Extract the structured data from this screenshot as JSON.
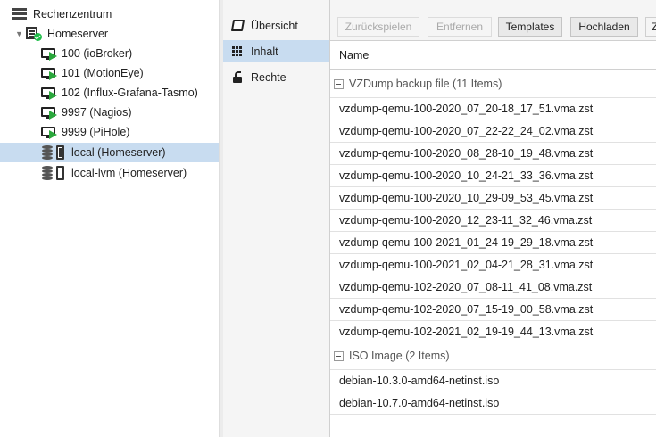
{
  "tree": {
    "datacenter": "Rechenzentrum",
    "node": "Homeserver",
    "vms": [
      {
        "label": "100 (ioBroker)"
      },
      {
        "label": "101 (MotionEye)"
      },
      {
        "label": "102 (Influx-Grafana-Tasmo)"
      },
      {
        "label": "9997 (Nagios)"
      },
      {
        "label": "9999 (PiHole)"
      }
    ],
    "storages": [
      {
        "label": "local (Homeserver)",
        "selected": true
      },
      {
        "label": "local-lvm (Homeserver)",
        "selected": false
      }
    ]
  },
  "nav": {
    "items": [
      {
        "label": "Übersicht",
        "icon": "book-icon"
      },
      {
        "label": "Inhalt",
        "icon": "grid-icon",
        "selected": true
      },
      {
        "label": "Rechte",
        "icon": "unlock-icon"
      }
    ]
  },
  "toolbar": {
    "restore": "Zurückspielen",
    "remove": "Entfernen",
    "templates": "Templates",
    "upload": "Hochladen",
    "overflow": "Z"
  },
  "grid": {
    "column_name": "Name",
    "groups": [
      {
        "title": "VZDump backup file (11 Items)",
        "items": [
          "vzdump-qemu-100-2020_07_20-18_17_51.vma.zst",
          "vzdump-qemu-100-2020_07_22-22_24_02.vma.zst",
          "vzdump-qemu-100-2020_08_28-10_19_48.vma.zst",
          "vzdump-qemu-100-2020_10_24-21_33_36.vma.zst",
          "vzdump-qemu-100-2020_10_29-09_53_45.vma.zst",
          "vzdump-qemu-100-2020_12_23-11_32_46.vma.zst",
          "vzdump-qemu-100-2021_01_24-19_29_18.vma.zst",
          "vzdump-qemu-100-2021_02_04-21_28_31.vma.zst",
          "vzdump-qemu-102-2020_07_08-11_41_08.vma.zst",
          "vzdump-qemu-102-2020_07_15-19_00_58.vma.zst",
          "vzdump-qemu-102-2021_02_19-19_44_13.vma.zst"
        ]
      },
      {
        "title": "ISO Image (2 Items)",
        "items": [
          "debian-10.3.0-amd64-netinst.iso",
          "debian-10.7.0-amd64-netinst.iso"
        ]
      }
    ]
  },
  "colors": {
    "selection": "#c8dcf0",
    "running_green": "#2aa83c",
    "node_ok_green": "#21bf4b"
  }
}
